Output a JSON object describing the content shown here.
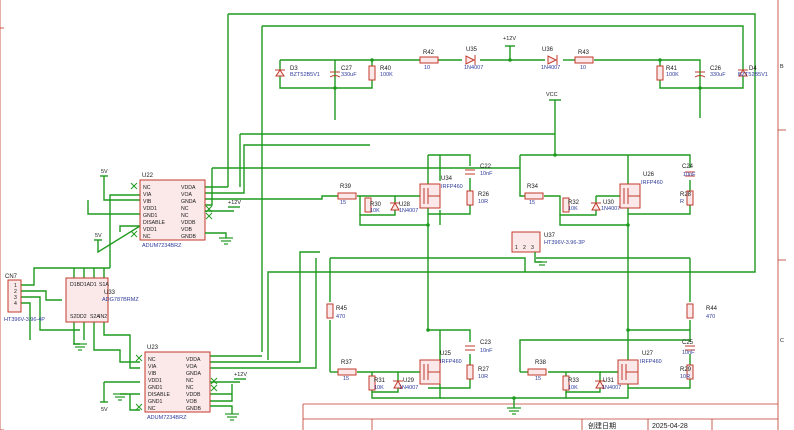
{
  "parts": {
    "D3": {
      "ref": "D3",
      "val": "BZT52B5V1"
    },
    "C27": {
      "ref": "C27",
      "val": "330uF"
    },
    "R40": {
      "ref": "R40",
      "val": "100K"
    },
    "R42": {
      "ref": "R42",
      "val": "10"
    },
    "U35": {
      "ref": "U35",
      "val": "1N4007"
    },
    "U36": {
      "ref": "U36",
      "val": "1N4007"
    },
    "R43": {
      "ref": "R43",
      "val": "10"
    },
    "R41": {
      "ref": "R41",
      "val": "100K"
    },
    "C26": {
      "ref": "C26",
      "val": "330uF"
    },
    "D4": {
      "ref": "D4",
      "val": "BZT52B5V1"
    },
    "U22": {
      "ref": "U22",
      "val": "ADUM7234BRZ"
    },
    "U23": {
      "ref": "U23",
      "val": "ADUM7234BRZ"
    },
    "U33": {
      "ref": "U33",
      "val": "ADG787BRMZ"
    },
    "CN7": {
      "ref": "CN7",
      "val": "HT396V-3.96-4P"
    },
    "U37": {
      "ref": "U37",
      "val": "HT396V-3.96-3P"
    },
    "R39": {
      "ref": "R39",
      "val": "15"
    },
    "R30": {
      "ref": "R30",
      "val": "10K"
    },
    "U28": {
      "ref": "U28",
      "val": "1N4007"
    },
    "U34": {
      "ref": "U34",
      "val": "IRFP460"
    },
    "C22": {
      "ref": "C22",
      "val": "10nF"
    },
    "R26": {
      "ref": "R26",
      "val": "10R"
    },
    "R34": {
      "ref": "R34",
      "val": "15"
    },
    "R32": {
      "ref": "R32",
      "val": "10K"
    },
    "U30": {
      "ref": "U30",
      "val": "1N4007"
    },
    "U26": {
      "ref": "U26",
      "val": "IRFP460"
    },
    "C24": {
      "ref": "C24",
      "val": "10nF"
    },
    "R28": {
      "ref": "R28",
      "val": "R"
    },
    "R45": {
      "ref": "R45",
      "val": "470"
    },
    "R44": {
      "ref": "R44",
      "val": "470"
    },
    "R37": {
      "ref": "R37",
      "val": "15"
    },
    "R31": {
      "ref": "R31",
      "val": "10K"
    },
    "U29": {
      "ref": "U29",
      "val": "1N4007"
    },
    "U25": {
      "ref": "U25",
      "val": "IRFP460"
    },
    "C23": {
      "ref": "C23",
      "val": "10nF"
    },
    "R27": {
      "ref": "R27",
      "val": "10R"
    },
    "R38": {
      "ref": "R38",
      "val": "15"
    },
    "R33": {
      "ref": "R33",
      "val": "10K"
    },
    "U31": {
      "ref": "U31",
      "val": "1N4007"
    },
    "U27": {
      "ref": "U27",
      "val": "IRFP460"
    },
    "C25": {
      "ref": "C25",
      "val": "10nF"
    },
    "R29": {
      "ref": "R29",
      "val": "10R"
    }
  },
  "power": {
    "p12_top": "+12V",
    "vcc": "VCC",
    "p12_u22": "+12V",
    "p12_u23": "+12V",
    "p5_a": "5V",
    "p5_b": "5V",
    "p5_c": "5V"
  },
  "adum_pins_left": [
    "NC",
    "VIA",
    "VIB",
    "VDD1",
    "GND1",
    "DISABLE",
    "VDD1",
    "NC"
  ],
  "adum_pins_right": [
    "VDDA",
    "VOA",
    "GNDA",
    "NC",
    "NC",
    "VDDB",
    "VOB",
    "GNDB"
  ],
  "u23_pins_left": [
    "NC",
    "VIA",
    "VIB",
    "VDD1",
    "GND1",
    "DISABLE",
    "GND1",
    "NC"
  ],
  "adg_pins_top": [
    "D1B",
    "D1A",
    "D1",
    "S1A"
  ],
  "adg_pins_bottom": [
    "S2D",
    "D2",
    "S2A",
    "IN2"
  ],
  "cn7_pins": [
    "1",
    "2",
    "3",
    "4"
  ],
  "u37_pins": [
    "1",
    "2",
    "3"
  ],
  "title_block": {
    "label": "创建日期",
    "date": "2025-04-28"
  },
  "frame": {
    "side_b": "B",
    "side_c": "C"
  },
  "colors": {
    "wire": "#1f9a1f",
    "part": "#c0392b",
    "value": "#2e3b9c",
    "background": "#ffffff"
  }
}
